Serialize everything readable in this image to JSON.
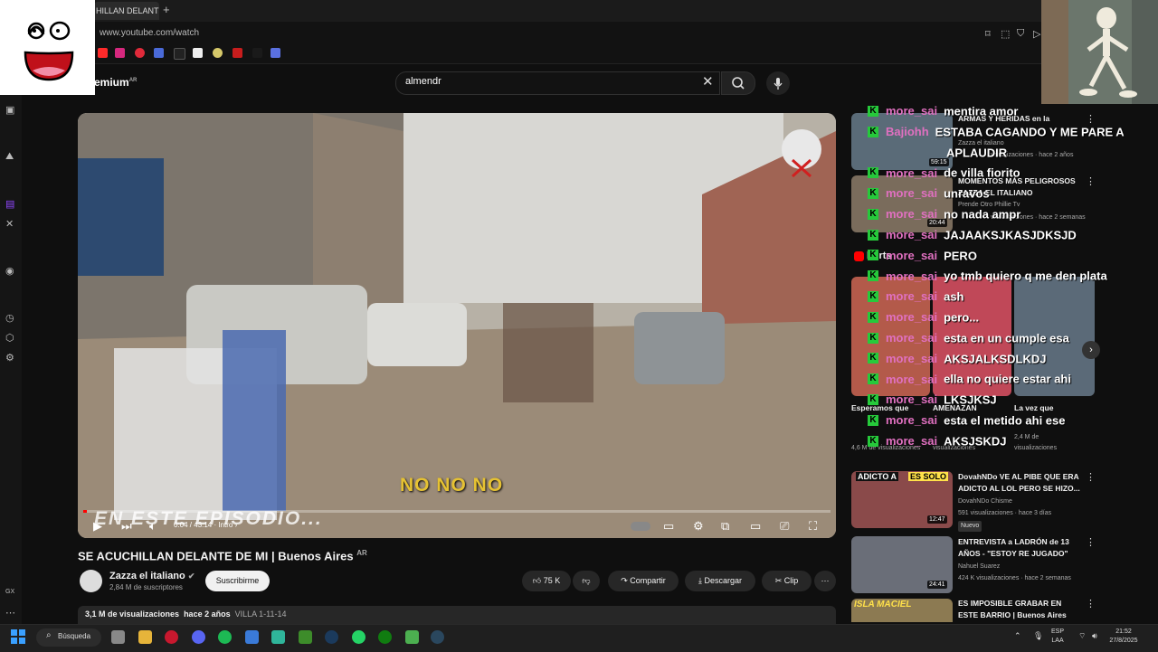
{
  "browser": {
    "tab_title": "HILLAN DELANTE",
    "url": "www.youtube.com/watch"
  },
  "youtube": {
    "logo_text": "emium",
    "logo_sup": "AR",
    "search_value": "almendr"
  },
  "video": {
    "subtitle": "NO NO NO",
    "overlay_text": "EN ESTE EPISODIO...",
    "current_time": "0:04 / 43:14",
    "chapter": "Intro",
    "progress_fraction": 0.001
  },
  "meta": {
    "title": "SE ACUCHILLAN DELANTE DE MI | Buenos Aires",
    "title_flag": "AR",
    "channel": "Zazza el italiano",
    "subscribers": "2,84 M de suscriptores",
    "subscribe_label": "Suscribirme",
    "likes": "75 K",
    "share_label": "Compartir",
    "download_label": "Descargar",
    "clip_label": "Clip",
    "views": "3,1 M de visualizaciones",
    "age": "hace 2 años",
    "tag": "VILLA 1-11-14"
  },
  "sidebar": {
    "items": [
      {
        "title1": "ARMAS Y HERIDAS en la",
        "title2": "",
        "channel": "Zazza el italiano",
        "meta": "visualizaciones · hace 2 años",
        "duration": "59:15",
        "color": "#5a6b78"
      },
      {
        "title1": "MOMENTOS MÁS PELIGROSOS",
        "title2": "ZAZZA EL ITALIANO",
        "channel": "Prende Otro Phillie Tv",
        "meta": "visualizaciones · hace 2 semanas",
        "duration": "20:44",
        "color": "#7a6c5c"
      },
      {
        "title1": "DovahNDo VE AL PIBE QUE ERA",
        "title2": "ADICTO AL LOL PERO SE HIZO...",
        "channel": "DovahNDo Chisme",
        "meta": "591 visualizaciones · hace 3 días",
        "duration": "12:47",
        "color": "#8a4a4a",
        "badge": "Nuevo"
      },
      {
        "title1": "ENTREVISTA a LADRÓN de 13",
        "title2": "AÑOS - \"ESTOY RE JUGADO\"",
        "channel": "Nahuel Suarez",
        "meta": "424 K visualizaciones · hace 2 semanas",
        "duration": "24:41",
        "color": "#6a6e78"
      },
      {
        "title1": "ES IMPOSIBLE GRABAR EN",
        "title2": "ESTE BARRIO | Buenos Aires",
        "channel": "",
        "meta": "",
        "duration": "",
        "color": "#8c7a52"
      }
    ],
    "shorts_label": "horts",
    "shorts": [
      {
        "title": "Esperamos que",
        "views": "4,6 M de visualizaciones"
      },
      {
        "title": "AMENAZAN",
        "views": "visualizaciones"
      },
      {
        "title": "La vez que",
        "views": "2,4 M de visualizaciones"
      }
    ],
    "thumb_labels": {
      "adicto": "ADICTO A",
      "es_solo": "ES SOLO",
      "isla": "ISLA MACIEL"
    }
  },
  "chat": [
    {
      "user": "more_sai",
      "msg": "mentira amor"
    },
    {
      "user": "Bajiohh",
      "msg": "ESTABA CAGANDO Y ME PARE A"
    },
    {
      "user": "",
      "msg": "APLAUDIR"
    },
    {
      "user": "more_sai",
      "msg": "de villa fiorito"
    },
    {
      "user": "more_sai",
      "msg": "unravos"
    },
    {
      "user": "more_sai",
      "msg": "no nada ampr"
    },
    {
      "user": "more_sai",
      "msg": "JAJAAKSJKASJDKSJD"
    },
    {
      "user": "more_sai",
      "msg": "PERO"
    },
    {
      "user": "more_sai",
      "msg": "yo tmb quiero q me den plata"
    },
    {
      "user": "more_sai",
      "msg": "ash"
    },
    {
      "user": "more_sai",
      "msg": "pero..."
    },
    {
      "user": "more_sai",
      "msg": "esta en un cumple esa"
    },
    {
      "user": "more_sai",
      "msg": "AKSJALKSDLKDJ"
    },
    {
      "user": "more_sai",
      "msg": "ella no quiere estar ahi"
    },
    {
      "user": "more_sai",
      "msg": "LKSJKSJ"
    },
    {
      "user": "more_sai",
      "msg": "esta el metido ahi ese"
    },
    {
      "user": "more_sai",
      "msg": "AKSJSKDJ"
    }
  ],
  "taskbar": {
    "search_label": "Búsqueda",
    "lang1": "ESP",
    "lang2": "LAA",
    "time": "21:52",
    "date": "27/8/2025"
  },
  "left_rail": {
    "gx": "GX"
  },
  "colors": {
    "chat_user": "#e070c0",
    "kick_green": "#26c93b",
    "subtitle": "#e6c233"
  }
}
